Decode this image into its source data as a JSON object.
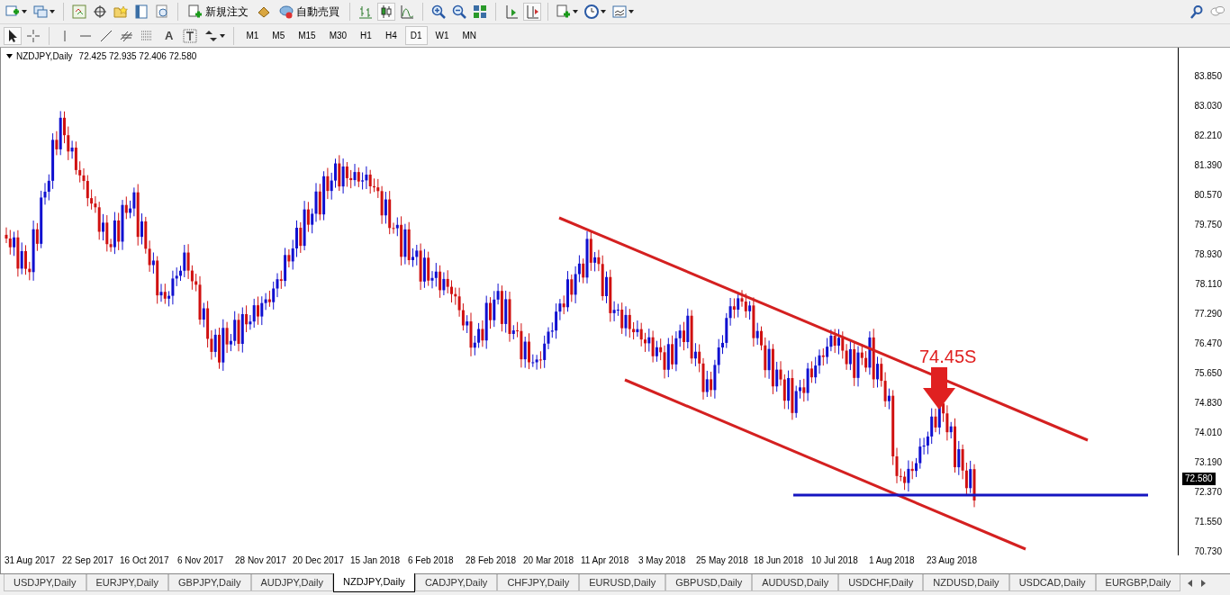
{
  "toolbar": {
    "new_order": "新規注文",
    "auto_trading": "自動売買",
    "text_tool": "A",
    "timeframes": [
      {
        "label": "M1",
        "selected": false
      },
      {
        "label": "M5",
        "selected": false
      },
      {
        "label": "M15",
        "selected": false
      },
      {
        "label": "M30",
        "selected": false
      },
      {
        "label": "H1",
        "selected": false
      },
      {
        "label": "H4",
        "selected": false
      },
      {
        "label": "D1",
        "selected": true
      },
      {
        "label": "W1",
        "selected": false
      },
      {
        "label": "MN",
        "selected": false
      }
    ]
  },
  "chart": {
    "symbol": "NZDJPY,Daily",
    "ohlc": "72.425 72.935 72.406 72.580",
    "price_labels": [
      "83.850",
      "83.030",
      "82.210",
      "81.390",
      "80.570",
      "79.750",
      "78.930",
      "78.110",
      "77.290",
      "76.470",
      "75.650",
      "74.830",
      "74.010",
      "73.190",
      "72.370",
      "71.550",
      "70.730"
    ],
    "current_price": "72.580",
    "date_labels": [
      "31 Aug 2017",
      "22 Sep 2017",
      "16 Oct 2017",
      "6 Nov 2017",
      "28 Nov 2017",
      "20 Dec 2017",
      "15 Jan 2018",
      "6 Feb 2018",
      "28 Feb 2018",
      "20 Mar 2018",
      "11 Apr 2018",
      "3 May 2018",
      "25 May 2018",
      "18 Jun 2018",
      "10 Jul 2018",
      "1 Aug 2018",
      "23 Aug 2018"
    ],
    "annotation": "74.45S"
  },
  "tabs": [
    {
      "label": "USDJPY,Daily",
      "selected": false
    },
    {
      "label": "EURJPY,Daily",
      "selected": false
    },
    {
      "label": "GBPJPY,Daily",
      "selected": false
    },
    {
      "label": "AUDJPY,Daily",
      "selected": false
    },
    {
      "label": "NZDJPY,Daily",
      "selected": true
    },
    {
      "label": "CADJPY,Daily",
      "selected": false
    },
    {
      "label": "CHFJPY,Daily",
      "selected": false
    },
    {
      "label": "EURUSD,Daily",
      "selected": false
    },
    {
      "label": "GBPUSD,Daily",
      "selected": false
    },
    {
      "label": "AUDUSD,Daily",
      "selected": false
    },
    {
      "label": "USDCHF,Daily",
      "selected": false
    },
    {
      "label": "NZDUSD,Daily",
      "selected": false
    },
    {
      "label": "USDCAD,Daily",
      "selected": false
    },
    {
      "label": "EURGBP,Daily",
      "selected": false
    }
  ]
}
